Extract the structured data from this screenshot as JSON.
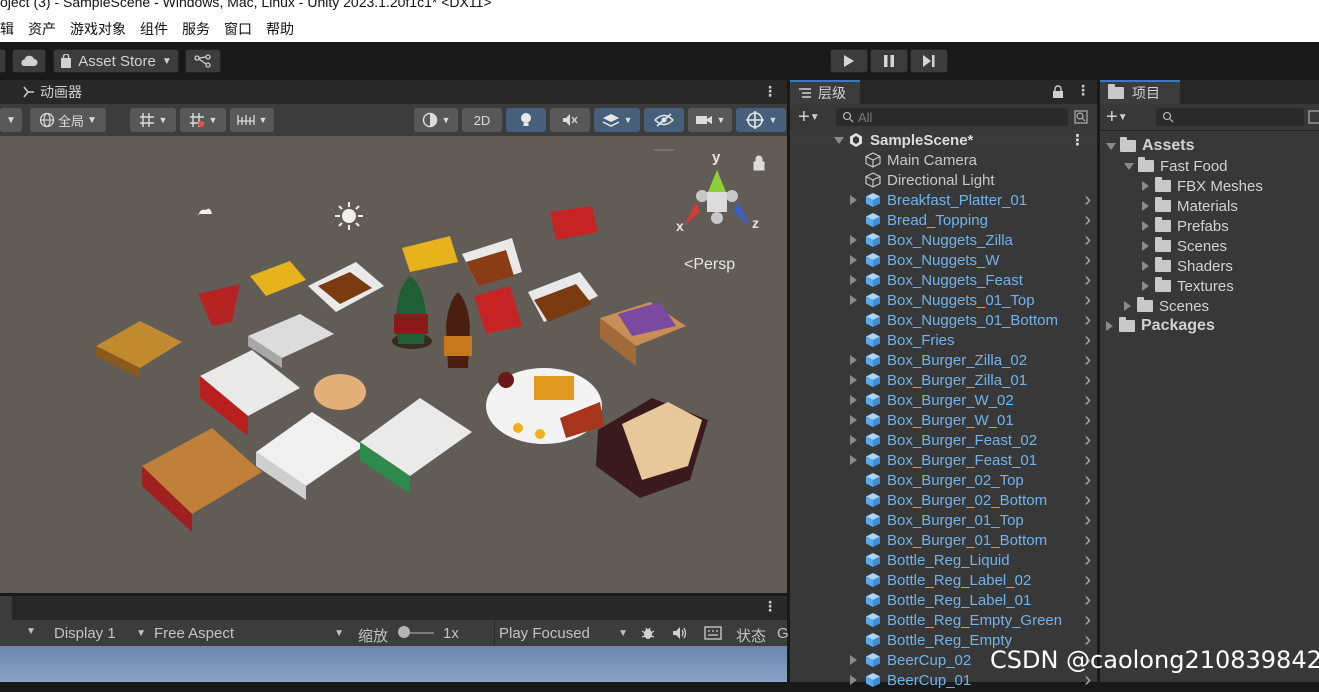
{
  "window": {
    "title": "oject (3) - SampleScene - Windows, Mac, Linux - Unity 2023.1.20f1c1* <DX11>"
  },
  "menu": [
    "辑",
    "资产",
    "游戏对象",
    "组件",
    "服务",
    "窗口",
    "帮助"
  ],
  "toolbar": {
    "asset_store_label": "Asset Store",
    "play_icon": "play-icon",
    "pause_icon": "pause-icon",
    "step_icon": "step-icon"
  },
  "scene_panel": {
    "tab_label": "动画器",
    "global_label": "全局",
    "mode_2d_label": "2D",
    "persp_label": "<Persp",
    "gizmo_axes": {
      "y": "y",
      "x": "x",
      "z": "z"
    }
  },
  "hierarchy": {
    "tab_label": "层级",
    "search_placeholder": "All",
    "scene_name": "SampleScene*",
    "items": [
      {
        "label": "Main Camera",
        "type": "plain",
        "expandable": false,
        "chevron": false
      },
      {
        "label": "Directional Light",
        "type": "plain",
        "expandable": false,
        "chevron": false
      },
      {
        "label": "Breakfast_Platter_01",
        "type": "prefab",
        "expandable": true,
        "chevron": true
      },
      {
        "label": "Bread_Topping",
        "type": "prefab",
        "expandable": false,
        "chevron": true
      },
      {
        "label": "Box_Nuggets_Zilla",
        "type": "prefab",
        "expandable": true,
        "chevron": true
      },
      {
        "label": "Box_Nuggets_W",
        "type": "prefab",
        "expandable": true,
        "chevron": true
      },
      {
        "label": "Box_Nuggets_Feast",
        "type": "prefab",
        "expandable": true,
        "chevron": true
      },
      {
        "label": "Box_Nuggets_01_Top",
        "type": "prefab",
        "expandable": true,
        "chevron": true
      },
      {
        "label": "Box_Nuggets_01_Bottom",
        "type": "prefab",
        "expandable": false,
        "chevron": true
      },
      {
        "label": "Box_Fries",
        "type": "prefab",
        "expandable": false,
        "chevron": true
      },
      {
        "label": "Box_Burger_Zilla_02",
        "type": "prefab",
        "expandable": true,
        "chevron": true
      },
      {
        "label": "Box_Burger_Zilla_01",
        "type": "prefab",
        "expandable": true,
        "chevron": true
      },
      {
        "label": "Box_Burger_W_02",
        "type": "prefab",
        "expandable": true,
        "chevron": true
      },
      {
        "label": "Box_Burger_W_01",
        "type": "prefab",
        "expandable": true,
        "chevron": true
      },
      {
        "label": "Box_Burger_Feast_02",
        "type": "prefab",
        "expandable": true,
        "chevron": true
      },
      {
        "label": "Box_Burger_Feast_01",
        "type": "prefab",
        "expandable": true,
        "chevron": true
      },
      {
        "label": "Box_Burger_02_Top",
        "type": "prefab",
        "expandable": false,
        "chevron": true
      },
      {
        "label": "Box_Burger_02_Bottom",
        "type": "prefab",
        "expandable": false,
        "chevron": true
      },
      {
        "label": "Box_Burger_01_Top",
        "type": "prefab",
        "expandable": false,
        "chevron": true
      },
      {
        "label": "Box_Burger_01_Bottom",
        "type": "prefab",
        "expandable": false,
        "chevron": true
      },
      {
        "label": "Bottle_Reg_Liquid",
        "type": "prefab",
        "expandable": false,
        "chevron": true
      },
      {
        "label": "Bottle_Reg_Label_02",
        "type": "prefab",
        "expandable": false,
        "chevron": true
      },
      {
        "label": "Bottle_Reg_Label_01",
        "type": "prefab",
        "expandable": false,
        "chevron": true
      },
      {
        "label": "Bottle_Reg_Empty_Green",
        "type": "prefab",
        "expandable": false,
        "chevron": true
      },
      {
        "label": "Bottle_Reg_Empty",
        "type": "prefab",
        "expandable": false,
        "chevron": true
      },
      {
        "label": "BeerCup_02",
        "type": "prefab",
        "expandable": true,
        "chevron": true
      },
      {
        "label": "BeerCup_01",
        "type": "prefab",
        "expandable": true,
        "chevron": true
      }
    ]
  },
  "project": {
    "tab_label": "项目",
    "tree": [
      {
        "label": "Assets",
        "level": 0,
        "state": "open",
        "bold": true
      },
      {
        "label": "Fast Food",
        "level": 1,
        "state": "open",
        "bold": false
      },
      {
        "label": "FBX Meshes",
        "level": 2,
        "state": "closed",
        "bold": false
      },
      {
        "label": "Materials",
        "level": 2,
        "state": "closed",
        "bold": false
      },
      {
        "label": "Prefabs",
        "level": 2,
        "state": "closed",
        "bold": false
      },
      {
        "label": "Scenes",
        "level": 2,
        "state": "closed",
        "bold": false
      },
      {
        "label": "Shaders",
        "level": 2,
        "state": "closed",
        "bold": false
      },
      {
        "label": "Textures",
        "level": 2,
        "state": "closed",
        "bold": false
      },
      {
        "label": "Scenes",
        "level": 1,
        "state": "closed",
        "bold": false
      },
      {
        "label": "Packages",
        "level": 0,
        "state": "closed",
        "bold": true
      }
    ]
  },
  "game_panel": {
    "display_label": "Display 1",
    "aspect_label": "Free Aspect",
    "scale_label": "缩放",
    "scale_value": "1x",
    "play_mode_label": "Play Focused",
    "stats_label": "状态",
    "gizmos_label": "G"
  },
  "watermark": "CSDN @caolong210839842"
}
